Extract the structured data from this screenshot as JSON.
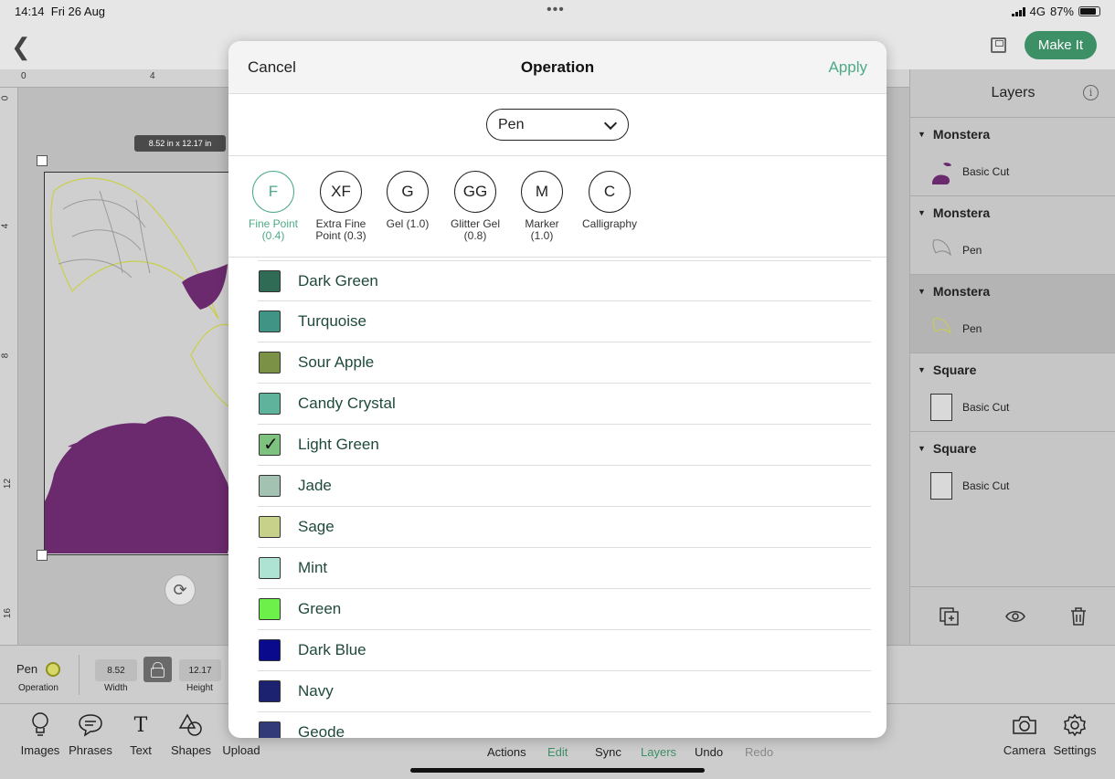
{
  "status_bar": {
    "time": "14:14",
    "date": "Fri 26 Aug",
    "network": "4G",
    "battery": "87%"
  },
  "top_bar": {
    "make_it_label": "Make It"
  },
  "canvas": {
    "ruler_top_labels": [
      "0",
      "4"
    ],
    "ruler_left_labels": [
      "0",
      "4",
      "8",
      "12",
      "16"
    ],
    "size_badge": "8.52 in x 12.17 in"
  },
  "layers_panel": {
    "title": "Layers",
    "groups": [
      {
        "name": "Monstera",
        "item": "Basic Cut"
      },
      {
        "name": "Monstera",
        "item": "Pen"
      },
      {
        "name": "Monstera",
        "item": "Pen"
      },
      {
        "name": "Square",
        "item": "Basic Cut"
      },
      {
        "name": "Square",
        "item": "Basic Cut"
      }
    ]
  },
  "operation_strip": {
    "operation_value": "Pen",
    "operation_label": "Operation",
    "width_value": "8.52",
    "width_label": "Width",
    "height_value": "12.17",
    "height_label": "Height"
  },
  "bottom_tools": [
    "Images",
    "Phrases",
    "Text",
    "Shapes",
    "Upload"
  ],
  "bottom_tabs": [
    "Actions",
    "Edit",
    "Sync",
    "Layers",
    "Undo",
    "Redo"
  ],
  "bottom_right_tools": [
    "Camera",
    "Settings"
  ],
  "dialog": {
    "cancel": "Cancel",
    "title": "Operation",
    "apply": "Apply",
    "selected_operation": "Pen",
    "tool_types": [
      {
        "abbr": "F",
        "line1": "Fine Point",
        "line2": "(0.4)"
      },
      {
        "abbr": "XF",
        "line1": "Extra Fine",
        "line2": "Point (0.3)"
      },
      {
        "abbr": "G",
        "line1": "Gel (1.0)",
        "line2": ""
      },
      {
        "abbr": "GG",
        "line1": "Glitter Gel",
        "line2": "(0.8)"
      },
      {
        "abbr": "M",
        "line1": "Marker",
        "line2": "(1.0)"
      },
      {
        "abbr": "C",
        "line1": "Calligraphy",
        "line2": ""
      }
    ],
    "active_tool": "F",
    "colors": [
      {
        "name": "Dark Green",
        "hex": "#2f6b55"
      },
      {
        "name": "Turquoise",
        "hex": "#3f9485"
      },
      {
        "name": "Sour Apple",
        "hex": "#7a9146"
      },
      {
        "name": "Candy Crystal",
        "hex": "#5fb39c"
      },
      {
        "name": "Light Green",
        "hex": "#7fc27f",
        "checked": true
      },
      {
        "name": "Jade",
        "hex": "#a3c2b1"
      },
      {
        "name": "Sage",
        "hex": "#c8d18a"
      },
      {
        "name": "Mint",
        "hex": "#aee3d4"
      },
      {
        "name": "Green",
        "hex": "#6df04a"
      },
      {
        "name": "Dark Blue",
        "hex": "#0a0a8c"
      },
      {
        "name": "Navy",
        "hex": "#1c2270"
      },
      {
        "name": "Geode",
        "hex": "#323a78"
      }
    ]
  },
  "accent": {
    "brand_green": "#3d8f66",
    "apply_green": "#4caa85",
    "artwork_purple": "#6b2a6e"
  }
}
